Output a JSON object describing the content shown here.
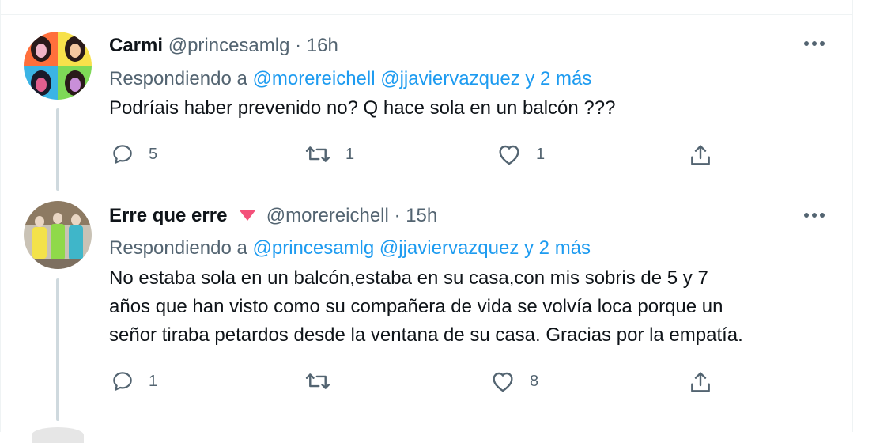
{
  "tweets": [
    {
      "name": "Carmi",
      "handle": "@princesamlg",
      "separator": "·",
      "time": "16h",
      "replying_prefix": "Respondiendo a",
      "replying_users": "@morereichell @jjaviervazquez",
      "replying_suffix": "y 2 más",
      "text": "Podríais haber prevenido no? Q hace sola en un balcón ???",
      "replies": "5",
      "retweets": "1",
      "likes": "1",
      "more_icon": "more-dots-icon"
    },
    {
      "name": "Erre que erre",
      "handle": "@morereichell",
      "separator": "·",
      "time": "15h",
      "replying_prefix": "Respondiendo a",
      "replying_users": "@princesamlg @jjaviervazquez",
      "replying_suffix": "y 2 más",
      "text_lines": [
        "No estaba sola en un balcón,estaba en su casa,con mis sobris de 5 y 7",
        "años que han visto como su compañera de vida se volvía loca porque un",
        "señor tiraba petardos desde la ventana de su casa. Gracias por la empatía."
      ],
      "replies": "1",
      "retweets": "",
      "likes": "8",
      "more_icon": "more-dots-icon"
    }
  ],
  "colors": {
    "link": "#1d9bf0",
    "muted": "#536471",
    "thread_line": "#cfd9de",
    "badge": "#f4212e"
  }
}
